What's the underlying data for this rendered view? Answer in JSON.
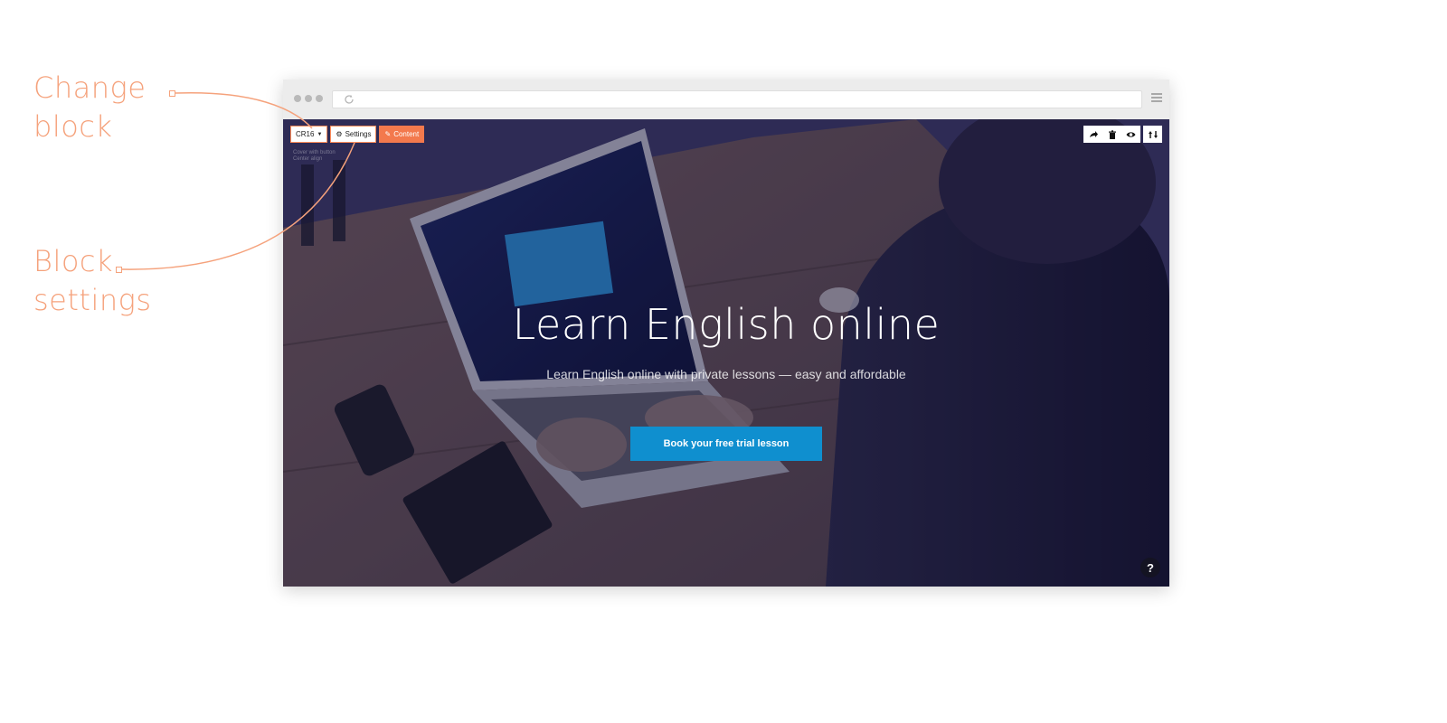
{
  "callouts": {
    "change_block": {
      "line1": "Change",
      "line2": "block"
    },
    "block_settings": {
      "line1": "Block",
      "line2": "settings"
    }
  },
  "browser": {
    "address_placeholder": "",
    "reload_icon": "reload-icon",
    "menu_icon": "hamburger-menu-icon"
  },
  "editor": {
    "block_selector_label": "CR16",
    "settings_label": "Settings",
    "content_label": "Content",
    "hint_line1": "Cover with button",
    "hint_line2": "Center align",
    "tools": [
      "forward-icon",
      "trash-icon",
      "eye-icon",
      "sort-icon"
    ]
  },
  "hero": {
    "headline": "Learn English online",
    "subline": "Learn English online with private lessons — easy and affordable",
    "cta_label": "Book your free trial lesson"
  },
  "help_label": "?",
  "colors": {
    "accent": "#f3794d",
    "callout": "#f5a27c",
    "cta": "#0f8fcf"
  }
}
